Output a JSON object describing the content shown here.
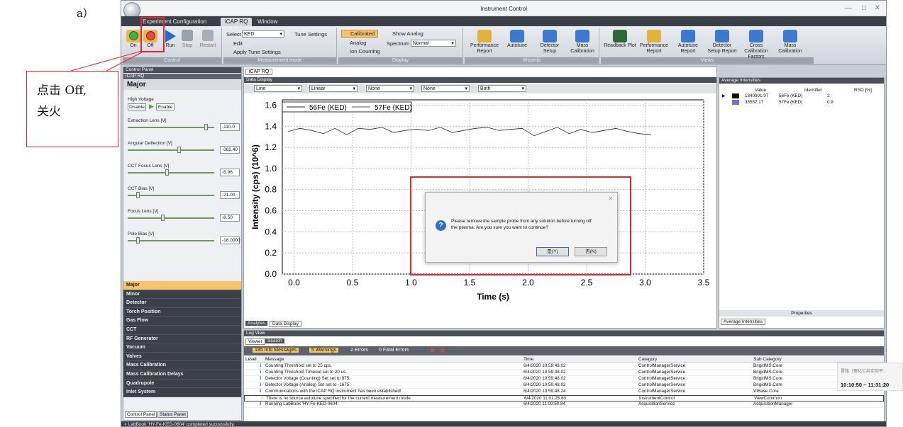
{
  "figure_label": "a）",
  "annotation": {
    "line1": "点击 Off,",
    "line2": "关火"
  },
  "window": {
    "title": "Instrument Control"
  },
  "tabs": [
    "Experiment Configuration",
    "iCAP RQ",
    "Window"
  ],
  "ribbon": {
    "control": {
      "title": "Control",
      "on": "On",
      "off": "Off",
      "run": "Run",
      "stop": "Stop",
      "restart": "Restart"
    },
    "measurement": {
      "title": "Measurement mode",
      "select_label": "Select",
      "select_value": "KED",
      "tune_settings": "Tune Settings",
      "edit": "Edit",
      "apply_tune": "Apply Tune Settings"
    },
    "display": {
      "title": "Display",
      "calibrated": "Calibrated",
      "analog": "Analog",
      "ion_counting": "Ion Counting",
      "show_analog": "Show Analog",
      "spectrum_label": "Spectrum",
      "spectrum_value": "Normal"
    },
    "wizards": {
      "title": "Wizards",
      "items": [
        "Performance Report",
        "Autotune",
        "Detector Setup",
        "Mass Calibration"
      ]
    },
    "views": {
      "title": "Views",
      "items": [
        "Readback Plot",
        "Performance Report",
        "Autotune Report",
        "Detector Setup Report",
        "Cross Calibration Factors",
        "Mass Calibration"
      ]
    }
  },
  "control_panel": {
    "header": "Control Panel",
    "sub": "iCAP RQ",
    "section": "Major",
    "hv_label": "High Voltage",
    "disable": "Disable",
    "enable": "Enable",
    "params": [
      {
        "label": "Extraction Lens [V]",
        "value": "-110.0",
        "pos": 0.92
      },
      {
        "label": "Angular Deflection [V]",
        "value": "-382.40",
        "pos": 0.6
      },
      {
        "label": "CCT Focus Lens [V]",
        "value": "-5.96",
        "pos": 0.45
      },
      {
        "label": "CCT Bias [V]",
        "value": "-21.00",
        "pos": 0.1
      },
      {
        "label": "Focus Lens [V]",
        "value": "-8.50",
        "pos": 0.4
      },
      {
        "label": "Pole Bias [V]",
        "value": "-18.0000",
        "pos": 0.1
      }
    ],
    "categories": [
      "Major",
      "Minor",
      "Detector",
      "Torch Position",
      "Gas Flow",
      "CCT",
      "RF Generator",
      "Vacuum",
      "Valves",
      "Mass Calibration",
      "Mass Calibration Delays",
      "Quadrupole",
      "Inlet System"
    ],
    "bottom_tabs": [
      "Control Panel",
      "Status Panel"
    ]
  },
  "center": {
    "tab": "iCAP RQ",
    "panel": "Data Display",
    "toolbar": [
      "Line",
      "Linear",
      "None",
      "None",
      "Both"
    ],
    "bottom_tabs": [
      "Analytes",
      "Data Display"
    ]
  },
  "chart_data": {
    "type": "line",
    "xlabel": "Time (s)",
    "ylabel": "Intensity (cps) (10^6)",
    "xlim": [
      -0.1,
      3.5
    ],
    "ylim": [
      0,
      1.65
    ],
    "xticks": [
      "0.0",
      "0.5",
      "1.0",
      "1.5",
      "2.0",
      "2.5",
      "3.0",
      "3.5"
    ],
    "yticks": [
      "0.0",
      "0.2",
      "0.4",
      "0.6",
      "0.8",
      "1.0",
      "1.2",
      "1.4",
      "1.6"
    ],
    "series": [
      {
        "name": "56Fe (KED)",
        "color": "#222222",
        "x": [
          -0.05,
          0.05,
          0.15,
          0.25,
          0.35,
          0.45,
          0.55,
          0.65,
          0.75,
          0.85,
          0.95,
          1.05,
          1.15,
          1.25,
          1.35,
          1.45,
          1.55,
          1.65,
          1.75,
          1.85,
          1.95,
          2.05,
          2.15,
          2.25,
          2.35,
          2.45,
          2.55,
          2.65,
          2.75,
          2.85,
          2.95,
          3.05
        ],
        "y": [
          1.35,
          1.38,
          1.36,
          1.33,
          1.38,
          1.32,
          1.38,
          1.37,
          1.39,
          1.34,
          1.36,
          1.37,
          1.36,
          1.39,
          1.34,
          1.36,
          1.38,
          1.39,
          1.36,
          1.37,
          1.38,
          1.31,
          1.35,
          1.39,
          1.33,
          1.37,
          1.34,
          1.36,
          1.38,
          1.35,
          1.33,
          1.32
        ]
      },
      {
        "name": "57Fe (KED)",
        "color": "#555555",
        "x": [],
        "y": []
      }
    ]
  },
  "dialog": {
    "message1": "Please remove the sample probe from any solution before turning off",
    "message2": "the plasma. Are you sure you want to continue?",
    "yes": "是(Y)",
    "no": "否(N)"
  },
  "avg_intensities": {
    "title": "Average Intensities",
    "cols": [
      "Value",
      "Identifier",
      "RSD [%]"
    ],
    "rows": [
      {
        "color": "#111111",
        "value": "1340991.97",
        "id": "56Fe (KED)",
        "rsd": "2"
      },
      {
        "color": "#7b6fc9",
        "value": "35557.17",
        "id": "57Fe (KED)",
        "rsd": "0.9"
      }
    ],
    "properties": "Properties",
    "bottom_tab": "Average Intensities"
  },
  "log": {
    "title": "Log View",
    "tabs": [
      "Viewer",
      "Search"
    ],
    "filters": {
      "info": "185 Info Messages",
      "warn": "5 Warnings",
      "err": "2 Errors",
      "fatal": "0 Fatal Errors"
    },
    "cols": [
      "Level",
      "Message",
      "Time",
      "Category",
      "Sub Category"
    ],
    "rows": [
      {
        "msg": "Counting Threshold set to 25 cps.",
        "time": "6/4/2020 10:59:48.02",
        "cat": "ControlManagerService",
        "sub": "BrigidMS.Core"
      },
      {
        "msg": "Counting Threshold Timeout set to 20 us.",
        "time": "6/4/2020 10:59:48.02",
        "cat": "ControlManagerService",
        "sub": "BrigidMS.Core"
      },
      {
        "msg": "Detector Voltage (Counting) Set set to 875.",
        "time": "6/4/2020 10:59:48.02",
        "cat": "ControlManagerService",
        "sub": "BrigidMS.Core"
      },
      {
        "msg": "Detector Voltage (Analog) Set set to -1675.",
        "time": "6/4/2020 10:59:48.02",
        "cat": "ControlManagerService",
        "sub": "BrigidMS.Core"
      },
      {
        "msg": "Communications with the iCAP RQ instrument has been established!",
        "time": "6/4/2020 10:59:48.24",
        "cat": "ControlManagerService",
        "sub": "VIBase.Core"
      },
      {
        "msg": "There is no source autotune specified for the current measurement mode.",
        "time": "6/4/2020 11:01:25.80",
        "cat": "InstrumentControl",
        "sub": "ViewCommon"
      },
      {
        "msg": "Running LabBook 'HY-Fe-KED-0604'",
        "time": "6/4/2020 11:09:50.84",
        "cat": "AcquisitionService",
        "sub": "AcquisitionManager"
      }
    ]
  },
  "status": "LabBook 'HY-Fe-KED-0604' completed successfully.",
  "side_overlay": {
    "text": "晋铭（理化公共实验平...",
    "time": "10:10:50 ~ 11:31:20"
  }
}
